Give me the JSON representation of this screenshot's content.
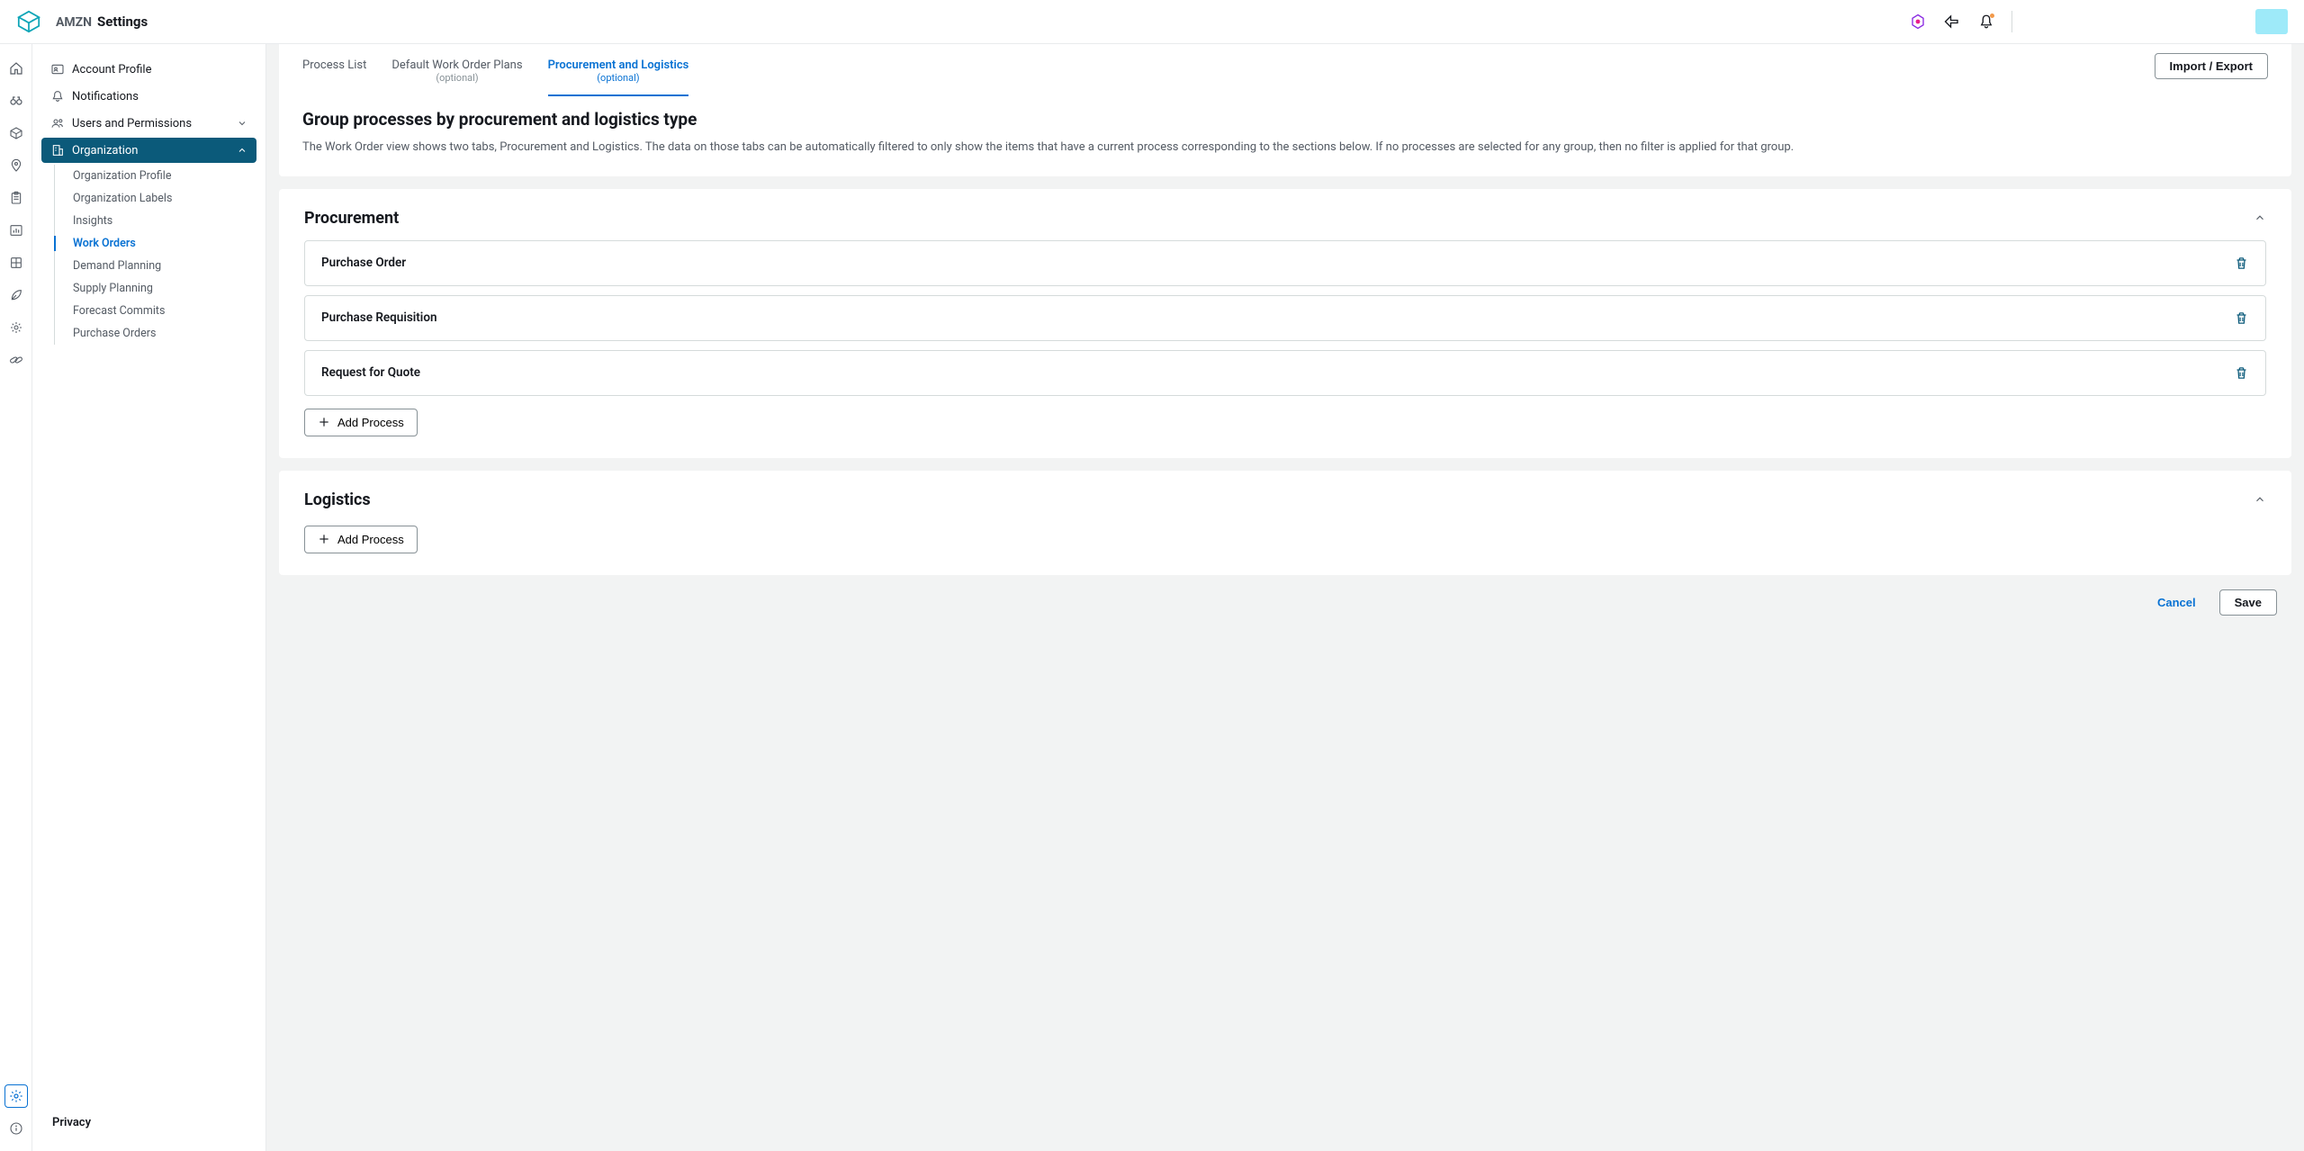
{
  "header": {
    "org": "AMZN",
    "page": "Settings"
  },
  "sidebar": {
    "items": [
      {
        "label": "Account Profile",
        "icon": "user-card-icon"
      },
      {
        "label": "Notifications",
        "icon": "bell-icon"
      },
      {
        "label": "Users and Permissions",
        "icon": "users-icon",
        "expandable": true
      },
      {
        "label": "Organization",
        "icon": "building-icon",
        "expandable": true,
        "expanded": true
      }
    ],
    "org_subitems": [
      {
        "label": "Organization Profile"
      },
      {
        "label": "Organization Labels"
      },
      {
        "label": "Insights"
      },
      {
        "label": "Work Orders",
        "active": true
      },
      {
        "label": "Demand Planning"
      },
      {
        "label": "Supply Planning"
      },
      {
        "label": "Forecast Commits"
      },
      {
        "label": "Purchase Orders"
      }
    ],
    "footer": "Privacy"
  },
  "tabs": [
    {
      "label": "Process List"
    },
    {
      "label": "Default Work Order Plans",
      "sub": "(optional)"
    },
    {
      "label": "Procurement and Logistics",
      "sub": "(optional)",
      "active": true
    }
  ],
  "import_export": "Import / Export",
  "page_title": "Group processes by procurement and logistics type",
  "page_desc": "The Work Order view shows two tabs, Procurement and Logistics. The data on those tabs can be automatically filtered to only show the items that have a current process corresponding to the sections below. If no processes are selected for any group, then no filter is applied for that group.",
  "sections": {
    "procurement": {
      "title": "Procurement",
      "processes": [
        {
          "name": "Purchase Order"
        },
        {
          "name": "Purchase Requisition"
        },
        {
          "name": "Request for Quote"
        }
      ],
      "add_label": "Add Process"
    },
    "logistics": {
      "title": "Logistics",
      "processes": [],
      "add_label": "Add Process"
    }
  },
  "actions": {
    "cancel": "Cancel",
    "save": "Save"
  }
}
